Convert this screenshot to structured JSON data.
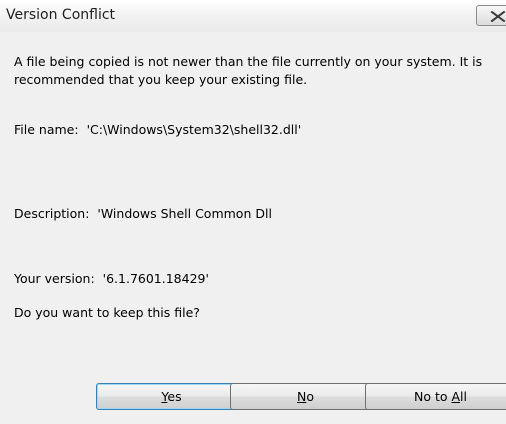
{
  "window": {
    "title": "Version Conflict"
  },
  "message": "A file being copied is not newer than the file currently on your system. It is recommended that you keep your existing file.",
  "file_name": {
    "label": "File name:",
    "value": "'C:\\Windows\\System32\\shell32.dll'"
  },
  "description": {
    "label": "Description:",
    "value": "'Windows Shell Common Dll"
  },
  "your_version": {
    "label": "Your version:",
    "value": "'6.1.7601.18429'"
  },
  "question": "Do you want to keep this file?",
  "buttons": {
    "yes": {
      "mnemonic": "Y",
      "rest": "es"
    },
    "no": {
      "mnemonic": "N",
      "rest": "o"
    },
    "no_to_all": {
      "prefix": "No to ",
      "mnemonic": "A",
      "rest": "ll"
    }
  },
  "icons": {
    "close": "close-icon"
  }
}
